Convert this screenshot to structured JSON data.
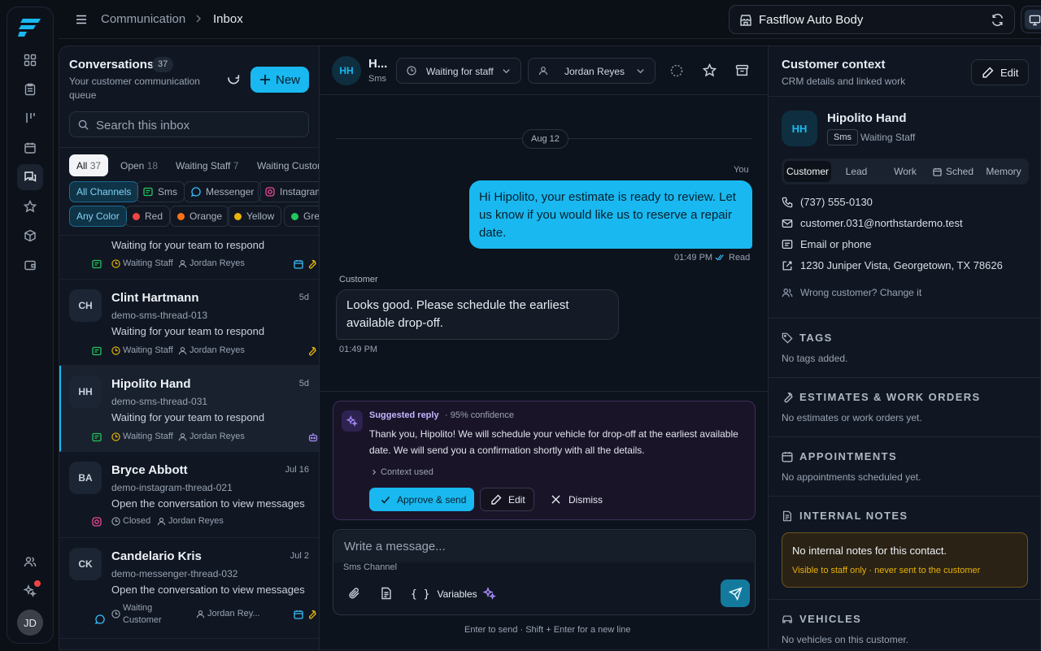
{
  "app": {
    "user_initials": "JD"
  },
  "topbar": {
    "crumb_parent": "Communication",
    "crumb_current": "Inbox",
    "shop_name": "Fastflow Auto Body"
  },
  "conversations": {
    "title": "Conversations",
    "count": "37",
    "subtitle": "Your customer communication queue",
    "new_label": "New",
    "search_placeholder": "Search this inbox",
    "status_tabs": [
      {
        "label": "All",
        "count": "37"
      },
      {
        "label": "Open",
        "count": "18"
      },
      {
        "label": "Waiting Staff",
        "count": "7"
      },
      {
        "label": "Waiting Custor",
        "count": ""
      }
    ],
    "channel_filters": [
      "All Channels",
      "Sms",
      "Messenger",
      "Instagram"
    ],
    "color_filters": [
      {
        "label": "Any Color",
        "color": ""
      },
      {
        "label": "Red",
        "color": "#ef4444"
      },
      {
        "label": "Orange",
        "color": "#f97316"
      },
      {
        "label": "Yellow",
        "color": "#eab308"
      },
      {
        "label": "Gree",
        "color": "#22c55e"
      }
    ],
    "items": [
      {
        "initials": "",
        "name": "",
        "time": "",
        "thread": "",
        "preview": "Waiting for your team to respond",
        "status": "Waiting Staff",
        "assignee": "Jordan Reyes"
      },
      {
        "initials": "CH",
        "name": "Clint Hartmann",
        "time": "5d",
        "thread": "demo-sms-thread-013",
        "preview": "Waiting for your team to respond",
        "status": "Waiting Staff",
        "assignee": "Jordan Reyes"
      },
      {
        "initials": "HH",
        "name": "Hipolito Hand",
        "time": "5d",
        "thread": "demo-sms-thread-031",
        "preview": "Waiting for your team to respond",
        "status": "Waiting Staff",
        "assignee": "Jordan Reyes"
      },
      {
        "initials": "BA",
        "name": "Bryce Abbott",
        "time": "Jul 16",
        "thread": "demo-instagram-thread-021",
        "preview": "Open the conversation to view messages",
        "status": "Closed",
        "assignee": "Jordan Reyes"
      },
      {
        "initials": "CK",
        "name": "Candelario Kris",
        "time": "Jul 2",
        "thread": "demo-messenger-thread-032",
        "preview": "Open the conversation to view messages",
        "status_line1": "Waiting",
        "status_line2": "Customer",
        "assignee": "Jordan Rey..."
      }
    ]
  },
  "thread": {
    "initials": "HH",
    "name": "H...",
    "channel": "Sms",
    "status_select": "Waiting for staff",
    "assignee_select": "Jordan Reyes",
    "date_divider": "Aug 12",
    "out_sender": "You",
    "out_text": "Hi Hipolito, your estimate is ready to review. Let us know if you would like us to reserve a repair date.",
    "out_time": "01:49 PM",
    "out_read": "Read",
    "in_sender": "Customer",
    "in_text": "Looks good. Please schedule the earliest available drop-off.",
    "in_time": "01:49 PM",
    "suggest": {
      "title": "Suggested reply",
      "confidence": "· 95% confidence",
      "text": "Thank you, Hipolito! We will schedule your vehicle for drop-off at the earliest available date. We will send you a confirmation shortly with all the details.",
      "context": "Context used",
      "approve": "Approve & send",
      "edit": "Edit",
      "dismiss": "Dismiss"
    },
    "composer": {
      "placeholder": "Write a message...",
      "channel": "Sms Channel",
      "variables": "Variables",
      "hint": "Enter to send · Shift + Enter for a new line"
    }
  },
  "context": {
    "title": "Customer context",
    "subtitle": "CRM details and linked work",
    "edit": "Edit",
    "initials": "HH",
    "name": "Hipolito Hand",
    "channel": "Sms",
    "status": "Waiting Staff",
    "tabs": [
      "Customer",
      "Lead",
      "Work",
      "Sched",
      "Memory"
    ],
    "phone": "(737) 555-0130",
    "email": "customer.031@northstardemo.test",
    "preferred": "Email or phone",
    "address": "1230 Juniper Vista, Georgetown, TX 78626",
    "wrong": "Wrong customer? Change it",
    "sections": {
      "tags": {
        "title": "TAGS",
        "body": "No tags added."
      },
      "estimates": {
        "title": "ESTIMATES & WORK ORDERS",
        "body": "No estimates or work orders yet."
      },
      "appointments": {
        "title": "APPOINTMENTS",
        "body": "No appointments scheduled yet."
      },
      "notes": {
        "title": "INTERNAL NOTES",
        "body": "No internal notes for this contact.",
        "hint": "Visible to staff only · never sent to the customer"
      },
      "vehicles": {
        "title": "VEHICLES",
        "body": "No vehicles on this customer."
      }
    }
  },
  "colors": {
    "accent": "#19b8f0",
    "bg": "#0b0f16",
    "panel": "#101722",
    "suggest_bg": "#1a1429",
    "note_bg": "#2a2214",
    "badge_red": "#ef4444"
  }
}
